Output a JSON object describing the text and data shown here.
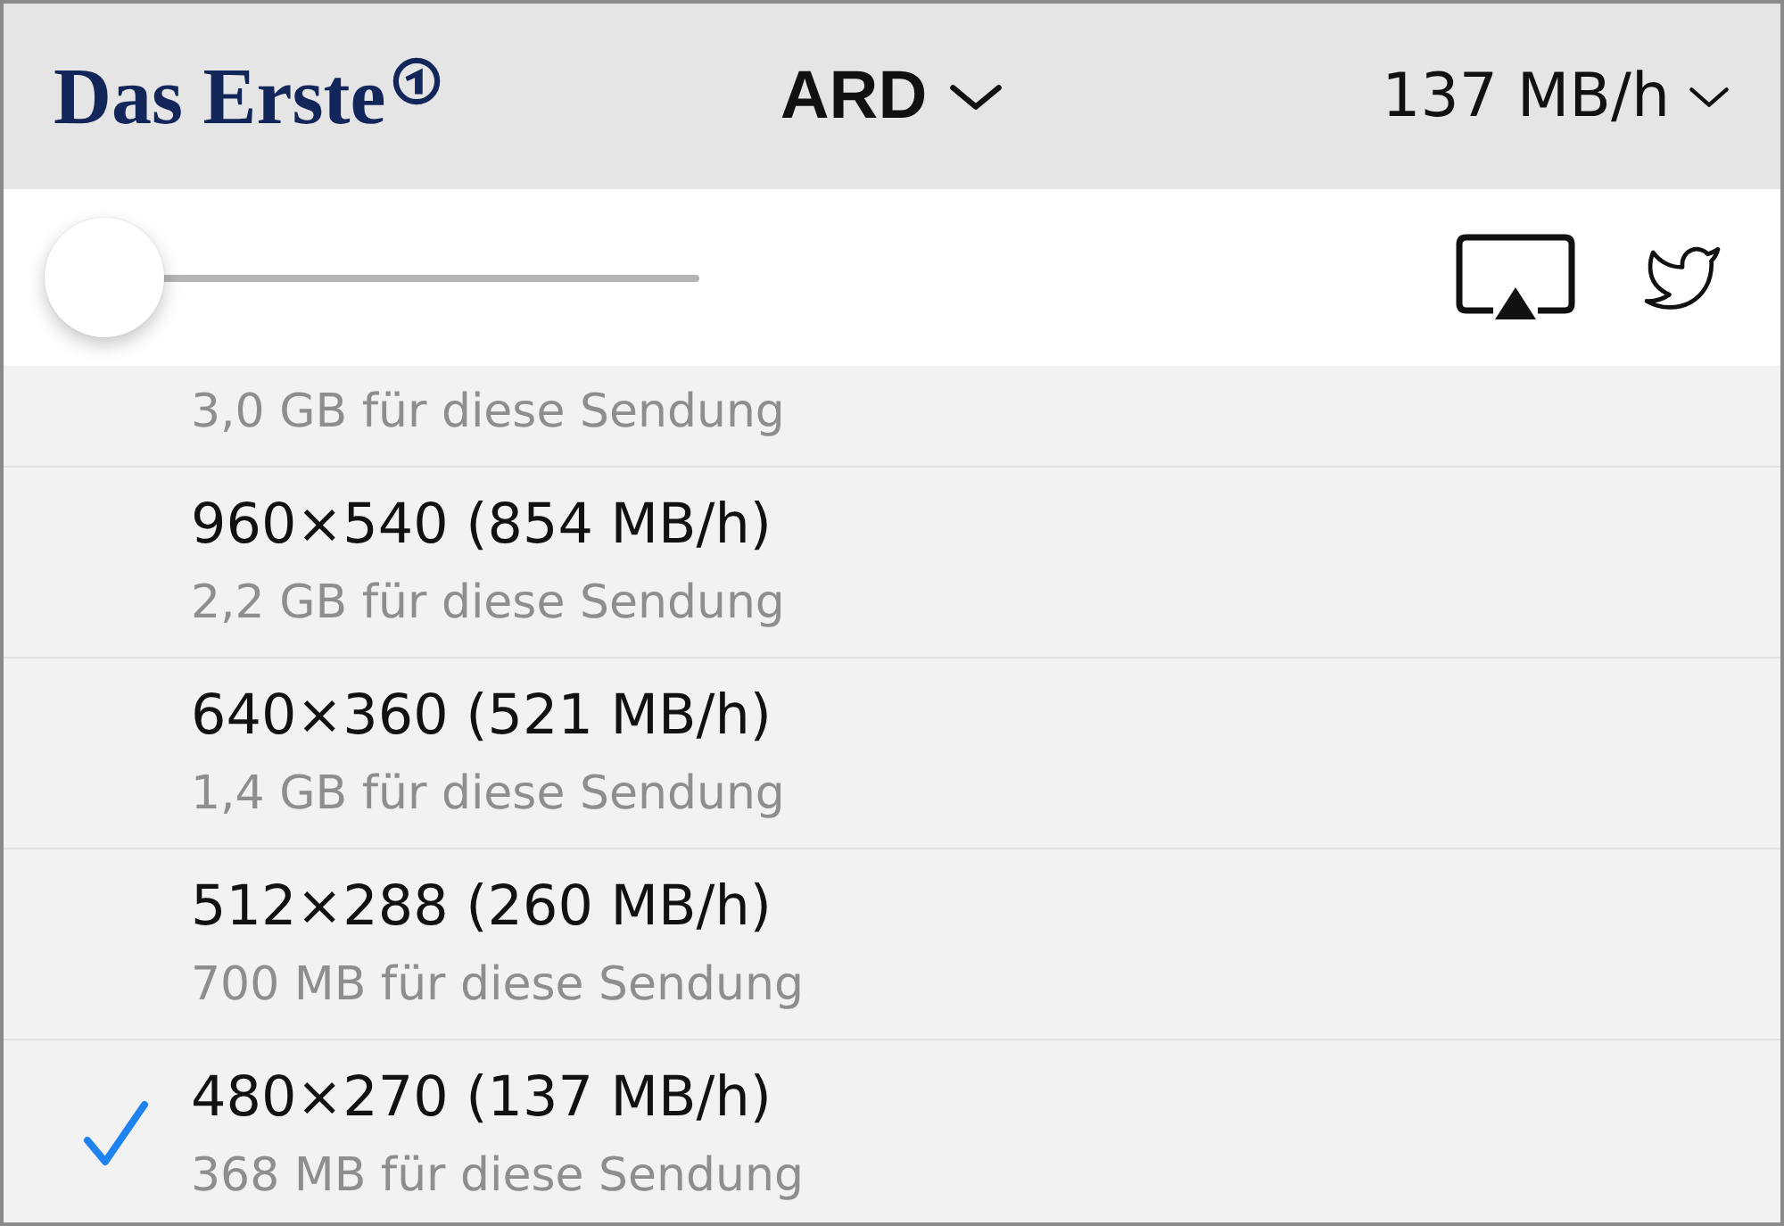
{
  "header": {
    "logo_text": "Das Erste",
    "channel": "ARD",
    "quality": "137 MB/h"
  },
  "slider": {
    "level": 0
  },
  "options": [
    {
      "subtitle": "3,0 GB für diese Sendung",
      "selected": false
    },
    {
      "title": "960×540 (854 MB/h)",
      "subtitle": "2,2 GB für diese Sendung",
      "selected": false
    },
    {
      "title": "640×360 (521 MB/h)",
      "subtitle": "1,4 GB für diese Sendung",
      "selected": false
    },
    {
      "title": "512×288 (260 MB/h)",
      "subtitle": "700 MB für diese Sendung",
      "selected": false
    },
    {
      "title": "480×270 (137 MB/h)",
      "subtitle": "368 MB für diese Sendung",
      "selected": true
    }
  ]
}
